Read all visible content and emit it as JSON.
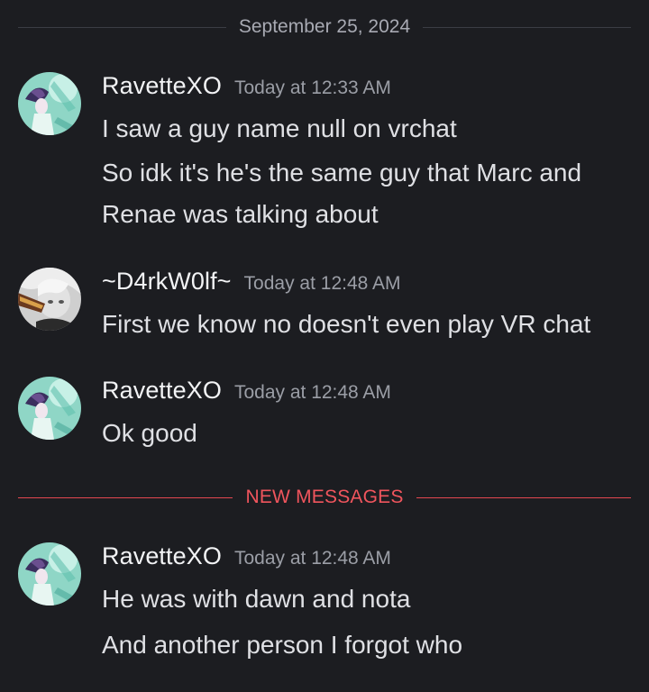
{
  "date_divider": {
    "label": "September 25, 2024"
  },
  "new_messages_divider": {
    "label": "NEW MESSAGES",
    "color": "#f0555d"
  },
  "messages": [
    {
      "username": "RavetteXO",
      "timestamp": "Today at 12:33 AM",
      "avatar": "ravette-avatar",
      "lines": [
        "I saw a guy name null on vrchat",
        "So idk it's he's the same guy that Marc and",
        "Renae was talking about"
      ]
    },
    {
      "username": "~D4rkW0lf~",
      "timestamp": "Today at 12:48 AM",
      "avatar": "darkwolf-avatar",
      "lines": [
        "First we know no doesn't even play VR chat"
      ]
    },
    {
      "username": "RavetteXO",
      "timestamp": "Today at 12:48 AM",
      "avatar": "ravette-avatar",
      "lines": [
        "Ok good"
      ]
    },
    {
      "username": "RavetteXO",
      "timestamp": "Today at 12:48 AM",
      "avatar": "ravette-avatar",
      "lines": [
        "He was with dawn and nota",
        "And another person I forgot who"
      ]
    }
  ],
  "colors": {
    "background": "#1c1d21",
    "divider_line": "#3b3d44",
    "new_messages_line": "#e34850",
    "timestamp": "#9b9ea6",
    "text": "#dfe0e4"
  }
}
